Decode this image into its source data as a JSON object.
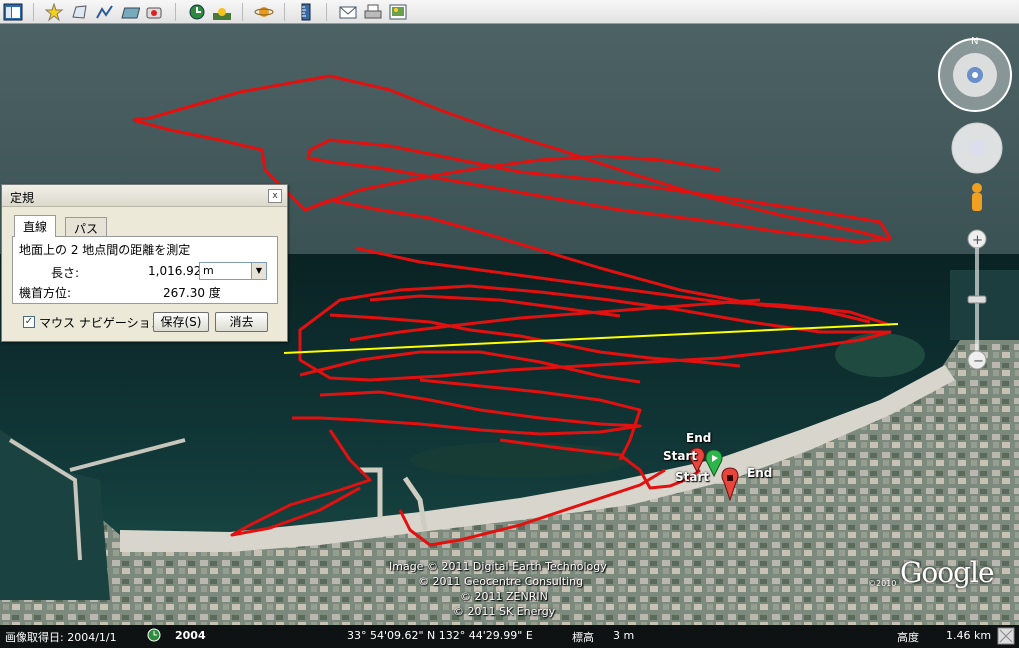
{
  "toolbar": {
    "icons": [
      "sidebar-toggle-icon",
      "add-placemark-icon",
      "add-polygon-icon",
      "add-path-icon",
      "add-image-overlay-icon",
      "record-tour-icon",
      "historical-imagery-icon",
      "sunlight-icon",
      "planets-icon",
      "ruler-icon",
      "email-icon",
      "print-icon",
      "save-image-icon"
    ]
  },
  "measure_dialog": {
    "title": "定規",
    "close_label": "x",
    "tabs": [
      {
        "label": "直線"
      },
      {
        "label": "パス"
      }
    ],
    "description": "地面上の 2 地点間の距離を測定",
    "length_label": "長さ:",
    "length_value": "1,016.92",
    "length_unit": "m",
    "heading_label": "機首方位:",
    "heading_value": "267.30 度",
    "mouse_nav_label": "マウス ナビゲーション",
    "mouse_nav_checked": true,
    "save_label": "保存(S)",
    "clear_label": "消去"
  },
  "markers": {
    "end_top": "End",
    "start_top": "Start",
    "start_bottom": "Start",
    "end_right": "End"
  },
  "attribution": [
    "Image © 2011 Digital Earth Technology",
    "© 2011 Geocentre Consulting",
    "© 2011 ZENRIN",
    "© 2011 SK Energy"
  ],
  "logo": {
    "text": "Google",
    "copyright": "©2010"
  },
  "status_bar": {
    "imagery_date_label": "画像取得日: 2004/1/1",
    "history_year": "2004",
    "coordinates": "33° 54'09.62\" N 132° 44'29.99\" E",
    "elevation_label": "標高",
    "elevation_value": "3 m",
    "eye_alt_label": "高度",
    "eye_alt_value": "1.46 km"
  },
  "colors": {
    "track": "#e31010",
    "measure_line": "#ffff00",
    "sea_deep": "#0e2a2c",
    "sea_top": "#3f5658"
  }
}
